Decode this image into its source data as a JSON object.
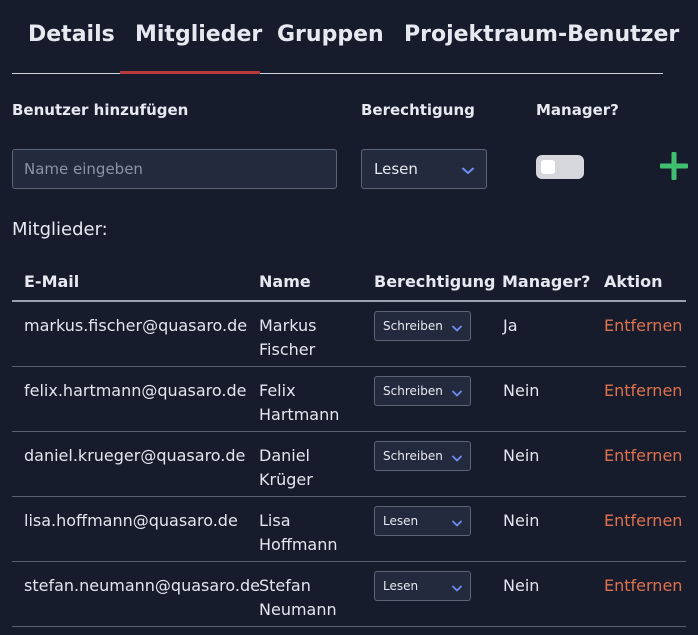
{
  "tabs": [
    {
      "label": "Details"
    },
    {
      "label": "Mitglieder"
    },
    {
      "label": "Gruppen"
    },
    {
      "label": "Projektraum-Benutzer"
    }
  ],
  "add_form": {
    "user_label": "Benutzer hinzufügen",
    "permission_label": "Berechtigung",
    "manager_label": "Manager?",
    "name_placeholder": "Name eingeben",
    "permission_value": "Lesen",
    "manager_enabled": false
  },
  "members": {
    "title": "Mitglieder:",
    "columns": [
      "E-Mail",
      "Name",
      "Berechtigung",
      "Manager?",
      "Aktion"
    ],
    "rows": [
      {
        "email": "markus.fischer@quasaro.de",
        "name": "Markus Fischer",
        "permission": "Schreiben",
        "manager": "Ja",
        "action": "Entfernen"
      },
      {
        "email": "felix.hartmann@quasaro.de",
        "name": "Felix Hartmann",
        "permission": "Schreiben",
        "manager": "Nein",
        "action": "Entfernen"
      },
      {
        "email": "daniel.krueger@quasaro.de",
        "name": "Daniel Krüger",
        "permission": "Schreiben",
        "manager": "Nein",
        "action": "Entfernen"
      },
      {
        "email": "lisa.hoffmann@quasaro.de",
        "name": "Lisa Hoffmann",
        "permission": "Lesen",
        "manager": "Nein",
        "action": "Entfernen"
      },
      {
        "email": "stefan.neumann@quasaro.de",
        "name": "Stefan Neumann",
        "permission": "Lesen",
        "manager": "Nein",
        "action": "Entfernen"
      }
    ]
  },
  "icons": {
    "add": "plus-icon",
    "dropdown": "chevron-down-icon"
  },
  "colors": {
    "background": "#161c2c",
    "active_tab_underline": "#b83a3a",
    "add_button": "#3fbf6f",
    "chevron": "#6f8cf0",
    "remove_link": "#e0714f"
  }
}
